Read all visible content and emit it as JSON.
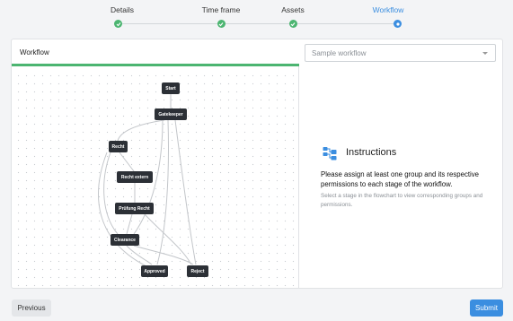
{
  "stepper": {
    "steps": [
      {
        "label": "Details",
        "state": "done"
      },
      {
        "label": "Time frame",
        "state": "done"
      },
      {
        "label": "Assets",
        "state": "done"
      },
      {
        "label": "Workflow",
        "state": "active"
      }
    ]
  },
  "card": {
    "title": "Workflow",
    "select_placeholder": "Sample workflow"
  },
  "flow": {
    "nodes": {
      "start": "Start",
      "gatekeeper": "Gatekeeper",
      "recht": "Recht",
      "recht_extern": "Recht extern",
      "pruefung": "Prüfung Recht",
      "clearance": "Clearance",
      "approved": "Approved",
      "reject": "Reject"
    }
  },
  "instructions": {
    "icon": "flowchart-icon",
    "title": "Instructions",
    "text": "Please assign at least one group and its respective permissions to each stage of the workflow.",
    "subtext": "Select a stage in the flowchart to view corresponding groups and permissions."
  },
  "footer": {
    "previous_label": "Previous",
    "submit_label": "Submit"
  },
  "colors": {
    "accent": "#3b8ee0",
    "success": "#4cb571",
    "node": "#2c3036"
  }
}
